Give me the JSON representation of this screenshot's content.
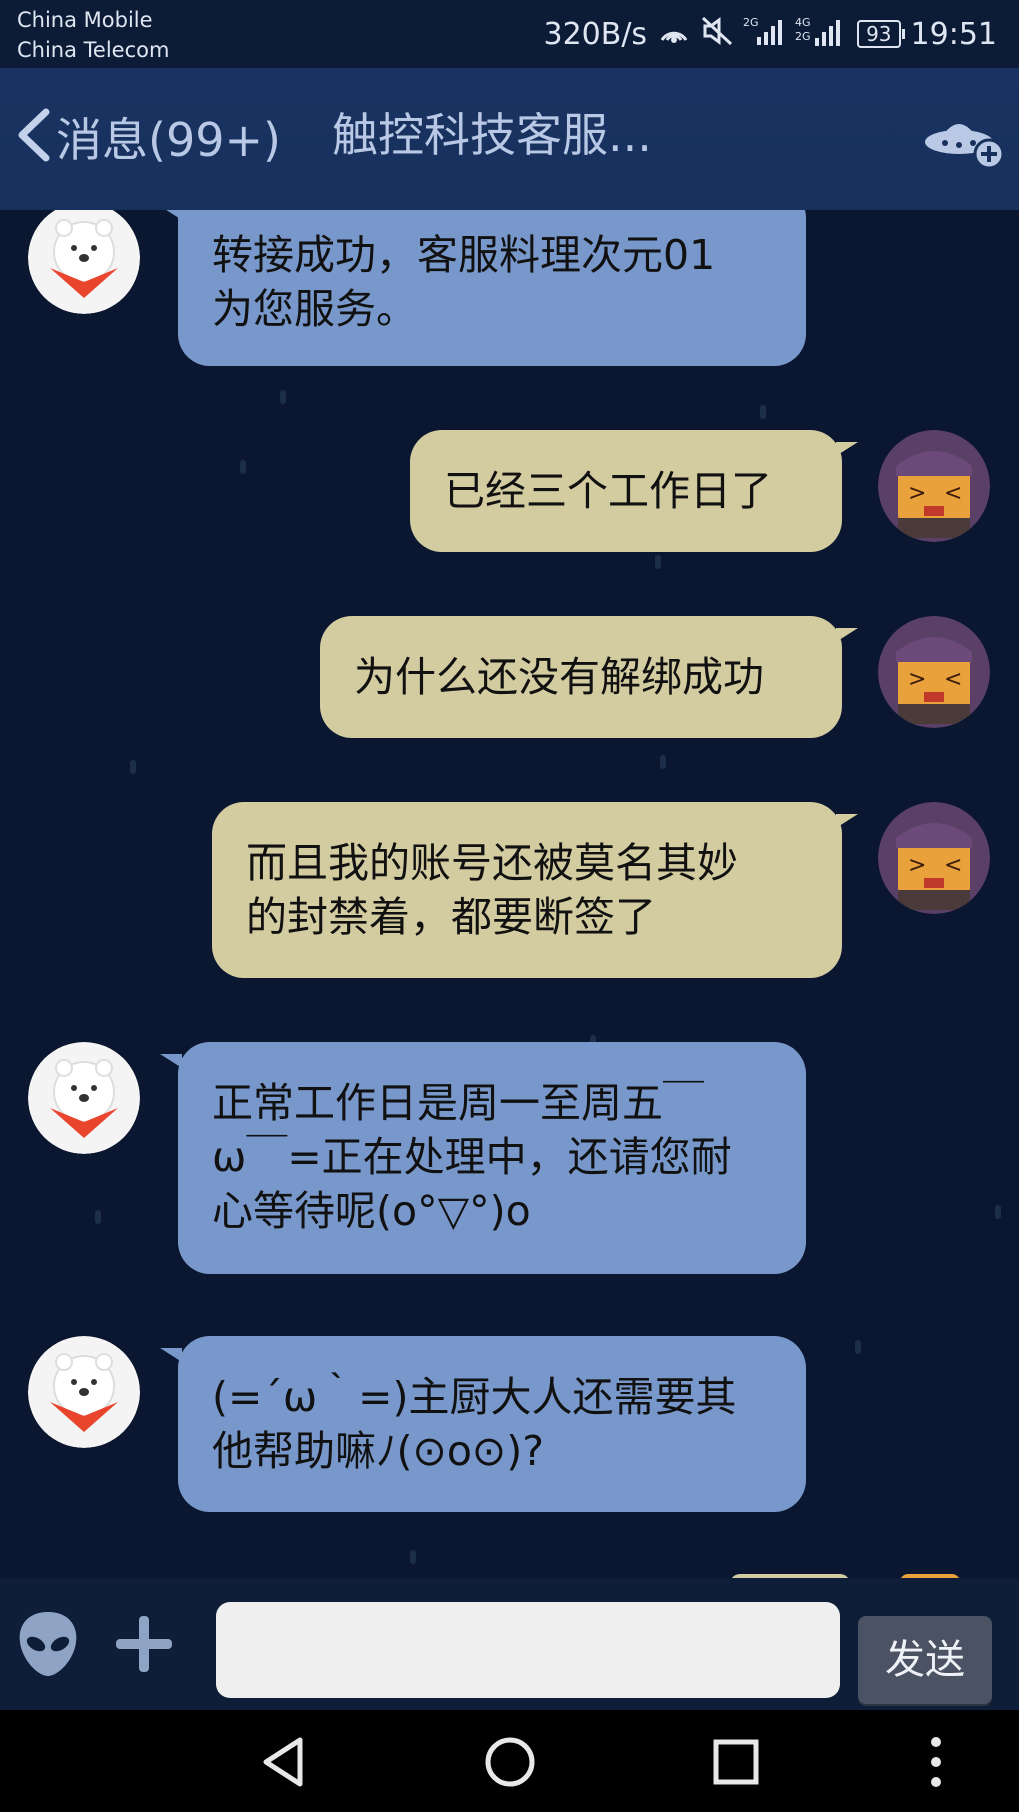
{
  "status_bar": {
    "carrier1": "China Mobile",
    "carrier2": "China Telecom",
    "network_speed": "320B/s",
    "signal1_label": "2G",
    "signal2_label": "4G 2G",
    "battery": "93",
    "time": "19:51"
  },
  "nav": {
    "back_label": "消息(99+)",
    "title": "触控科技客服..."
  },
  "messages": [
    {
      "sender": "service",
      "lines": [
        "转接成功，客服料理次元01",
        "为您服务。"
      ]
    },
    {
      "sender": "user",
      "lines": [
        "已经三个工作日了"
      ]
    },
    {
      "sender": "user",
      "lines": [
        "为什么还没有解绑成功"
      ]
    },
    {
      "sender": "user",
      "lines": [
        "而且我的账号还被莫名其妙",
        "的封禁着，都要断签了"
      ]
    },
    {
      "sender": "service",
      "lines": [
        "正常工作日是周一至周五￣",
        "ω￣=正在处理中，还请您耐",
        "心等待呢(o°▽°)o"
      ]
    },
    {
      "sender": "service",
      "lines": [
        "(=´ω｀=)主厨大人还需要其",
        "他帮助嘛ﾉ(⊙o⊙)?"
      ]
    }
  ],
  "input": {
    "placeholder": "",
    "value": "",
    "send_label": "发送"
  },
  "colors": {
    "service_bubble": "#7898cb",
    "user_bubble": "#d3cca1",
    "background": "#0b1730",
    "nav_background": "#1a3362"
  }
}
